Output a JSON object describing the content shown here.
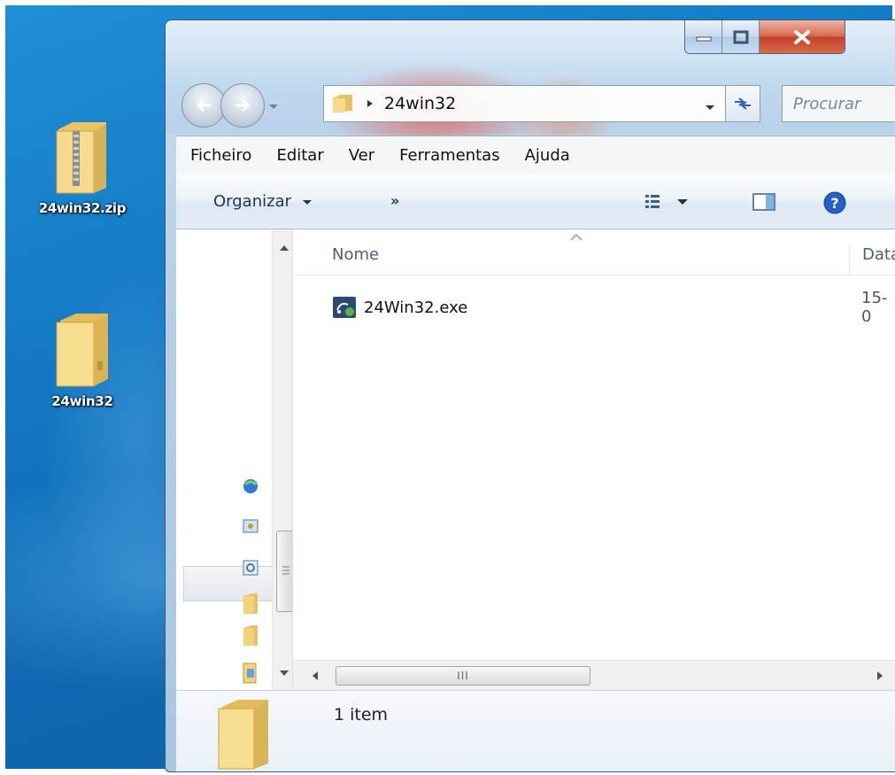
{
  "desktop": {
    "icons": [
      {
        "label": "24win32.zip",
        "type": "zip-folder"
      },
      {
        "label": "24win32",
        "type": "folder"
      }
    ]
  },
  "window": {
    "address_path": "24win32",
    "search_placeholder": "Procurar",
    "menu": [
      "Ficheiro",
      "Editar",
      "Ver",
      "Ferramentas",
      "Ajuda"
    ],
    "toolbar": {
      "organize_label": "Organizar",
      "more_label": "»"
    },
    "columns": [
      "Nome",
      "Data"
    ],
    "files": [
      {
        "name": "24Win32.exe",
        "date": "15-0"
      }
    ],
    "hscroll_grip": "III",
    "status": {
      "item_count": "1 item"
    }
  },
  "colors": {
    "desktop_blue": "#1378c3",
    "window_glass": "#b6cfe6",
    "close_red": "#c7402a",
    "folder_yellow": "#f3d27a"
  }
}
